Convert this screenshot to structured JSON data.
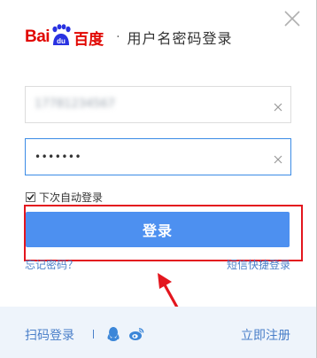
{
  "header": {
    "logo_latin": "Bai",
    "logo_paw_text": "du",
    "logo_chinese": "百度",
    "separator": "·",
    "title": "用户名密码登录"
  },
  "form": {
    "username_value": "17781234567",
    "password_mask": "•••••••",
    "remember_label": "下次自动登录",
    "remember_checked": true,
    "login_button": "登录",
    "forgot_link": "忘记密码？",
    "sms_link": "短信快捷登录"
  },
  "footer": {
    "qr_login": "扫码登录",
    "register": "立即注册",
    "icons": [
      "qq-icon",
      "weibo-icon"
    ]
  },
  "colors": {
    "brand_red": "#e10601",
    "brand_blue": "#2932e1",
    "button_blue": "#4d90f0",
    "link_blue": "#4a7fc9",
    "annotation_red": "#e3161e",
    "footer_bg": "#eef4fb"
  }
}
